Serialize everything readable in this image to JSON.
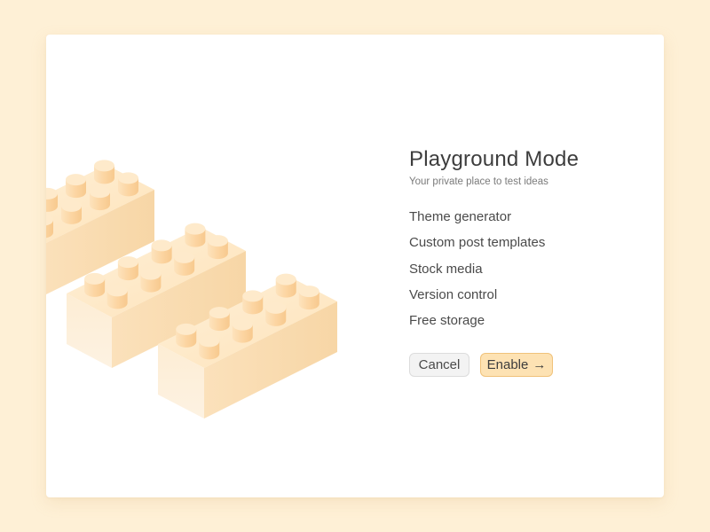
{
  "dialog": {
    "title": "Playground Mode",
    "subtitle": "Your private place to test ideas",
    "features": [
      "Theme generator",
      "Custom post templates",
      "Stock media",
      "Version control",
      "Free storage"
    ],
    "cancel_label": "Cancel",
    "enable_label": "Enable",
    "enable_icon": "arrow-right-icon",
    "enable_glyph": "→"
  },
  "colors": {
    "backdrop": "#fef0d6",
    "dialog": "#ffffff",
    "brick_top": "#fde6c2",
    "brick_left": "#fcebd1",
    "brick_right": "#f8dcb2",
    "stud_side": "#fcd9a8",
    "stud_top": "#feeacb",
    "enable_bg": "#fde2b3",
    "enable_border": "#f0c27a"
  },
  "illustration": {
    "name": "lego-bricks-illustration",
    "bricks": 3
  }
}
